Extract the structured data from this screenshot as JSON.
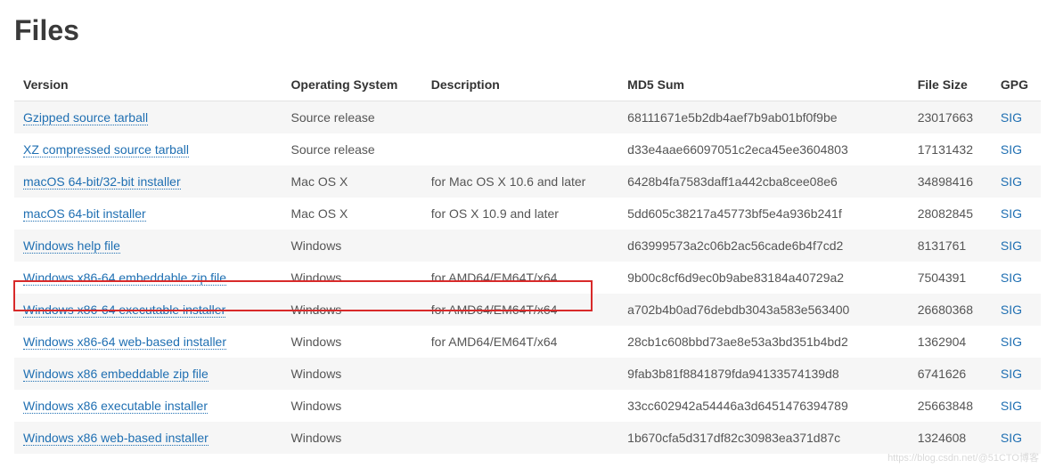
{
  "heading": "Files",
  "columns": [
    "Version",
    "Operating System",
    "Description",
    "MD5 Sum",
    "File Size",
    "GPG"
  ],
  "sig_label": "SIG",
  "rows": [
    {
      "version": "Gzipped source tarball",
      "os": "Source release",
      "desc": "",
      "md5": "68111671e5b2db4aef7b9ab01bf0f9be",
      "size": "23017663"
    },
    {
      "version": "XZ compressed source tarball",
      "os": "Source release",
      "desc": "",
      "md5": "d33e4aae66097051c2eca45ee3604803",
      "size": "17131432"
    },
    {
      "version": "macOS 64-bit/32-bit installer",
      "os": "Mac OS X",
      "desc": "for Mac OS X 10.6 and later",
      "md5": "6428b4fa7583daff1a442cba8cee08e6",
      "size": "34898416"
    },
    {
      "version": "macOS 64-bit installer",
      "os": "Mac OS X",
      "desc": "for OS X 10.9 and later",
      "md5": "5dd605c38217a45773bf5e4a936b241f",
      "size": "28082845"
    },
    {
      "version": "Windows help file",
      "os": "Windows",
      "desc": "",
      "md5": "d63999573a2c06b2ac56cade6b4f7cd2",
      "size": "8131761"
    },
    {
      "version": "Windows x86-64 embeddable zip file",
      "os": "Windows",
      "desc": "for AMD64/EM64T/x64",
      "md5": "9b00c8cf6d9ec0b9abe83184a40729a2",
      "size": "7504391"
    },
    {
      "version": "Windows x86-64 executable installer",
      "os": "Windows",
      "desc": "for AMD64/EM64T/x64",
      "md5": "a702b4b0ad76debdb3043a583e563400",
      "size": "26680368"
    },
    {
      "version": "Windows x86-64 web-based installer",
      "os": "Windows",
      "desc": "for AMD64/EM64T/x64",
      "md5": "28cb1c608bbd73ae8e53a3bd351b4bd2",
      "size": "1362904"
    },
    {
      "version": "Windows x86 embeddable zip file",
      "os": "Windows",
      "desc": "",
      "md5": "9fab3b81f8841879fda94133574139d8",
      "size": "6741626"
    },
    {
      "version": "Windows x86 executable installer",
      "os": "Windows",
      "desc": "",
      "md5": "33cc602942a54446a3d6451476394789",
      "size": "25663848"
    },
    {
      "version": "Windows x86 web-based installer",
      "os": "Windows",
      "desc": "",
      "md5": "1b670cfa5d317df82c30983ea371d87c",
      "size": "1324608"
    }
  ],
  "watermark": "https://blog.csdn.net/@51CTO博客"
}
